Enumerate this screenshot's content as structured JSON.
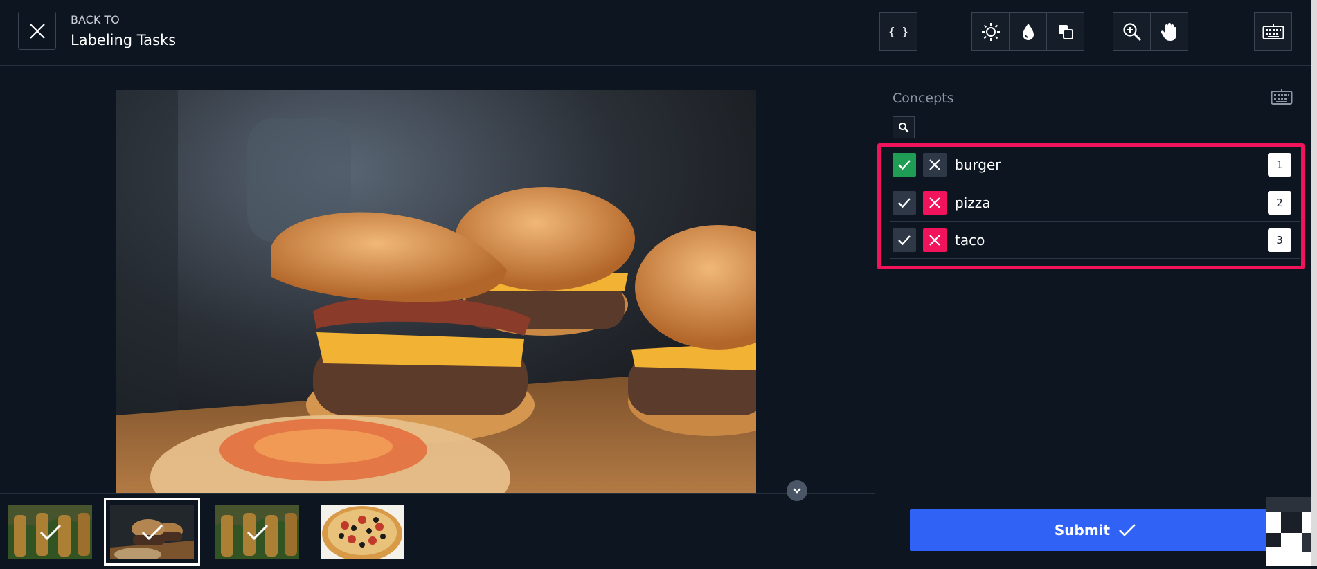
{
  "header": {
    "back_label": "BACK TO",
    "back_title": "Labeling Tasks",
    "tools": [
      "close-icon",
      "json-icon",
      "brightness-icon",
      "saturation-icon",
      "invert-icon",
      "zoom-in-icon",
      "pan-hand-icon",
      "keyboard-icon"
    ]
  },
  "json_button_label": "{ }",
  "sidebar": {
    "title": "Concepts",
    "concepts": [
      {
        "name": "burger",
        "hotkey": "1",
        "state": "yes"
      },
      {
        "name": "pizza",
        "hotkey": "2",
        "state": "no"
      },
      {
        "name": "taco",
        "hotkey": "3",
        "state": "no"
      }
    ]
  },
  "submit": {
    "label": "Submit"
  },
  "thumbnails": [
    {
      "subject": "taco",
      "labeled": true,
      "selected": false
    },
    {
      "subject": "burger",
      "labeled": true,
      "selected": true
    },
    {
      "subject": "taco",
      "labeled": true,
      "selected": false
    },
    {
      "subject": "pizza",
      "labeled": false,
      "selected": false
    }
  ],
  "colors": {
    "background": "#0d1521",
    "accent": "#2f62f5",
    "yes_active": "#1f9d55",
    "no_active": "#f2135d",
    "highlight": "#f2135d"
  }
}
